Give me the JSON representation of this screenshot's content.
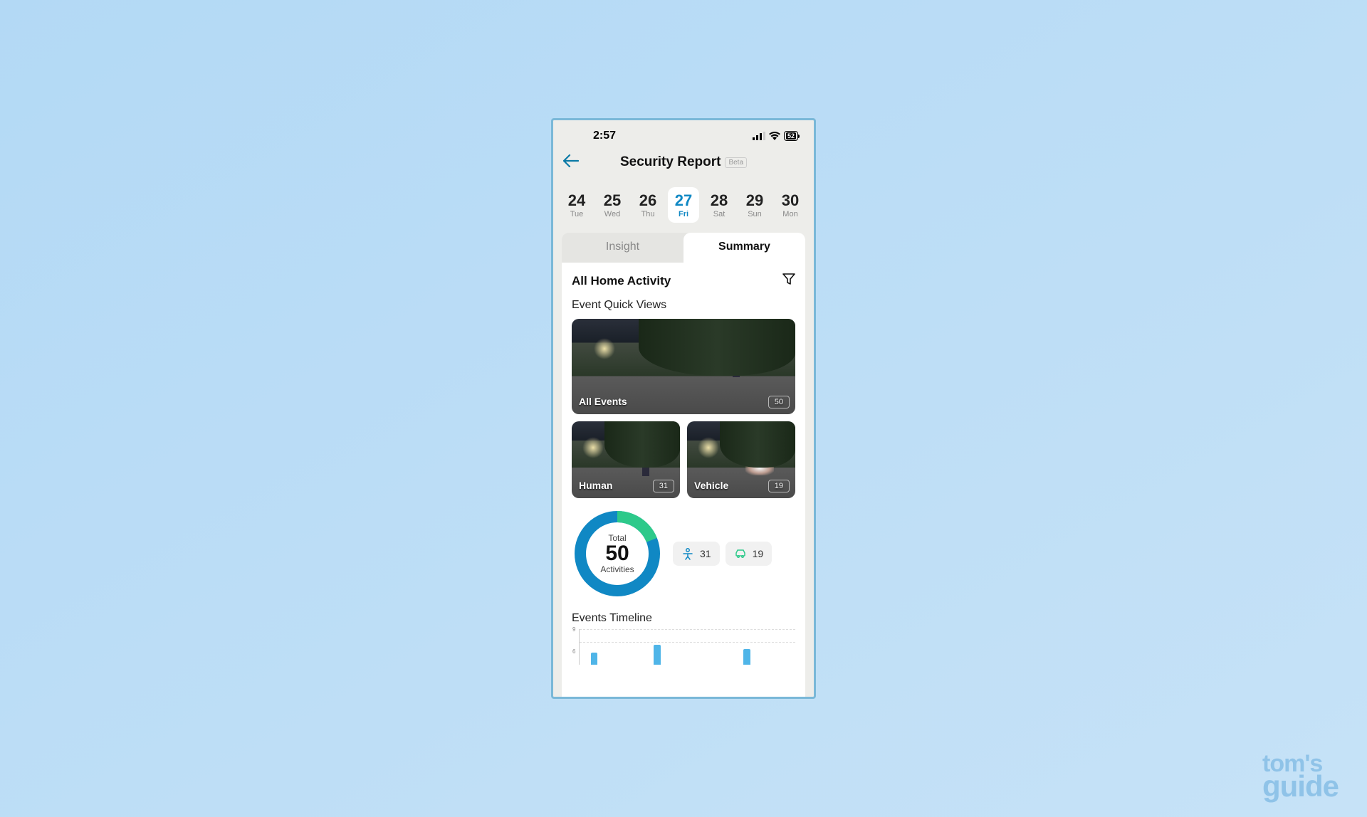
{
  "status": {
    "time": "2:57",
    "battery": "52"
  },
  "header": {
    "title": "Security Report",
    "badge": "Beta"
  },
  "dates": [
    {
      "num": "24",
      "day": "Tue"
    },
    {
      "num": "25",
      "day": "Wed"
    },
    {
      "num": "26",
      "day": "Thu"
    },
    {
      "num": "27",
      "day": "Fri",
      "selected": true
    },
    {
      "num": "28",
      "day": "Sat"
    },
    {
      "num": "29",
      "day": "Sun"
    },
    {
      "num": "30",
      "day": "Mon"
    }
  ],
  "tabs": {
    "insight": "Insight",
    "summary": "Summary",
    "active": "summary"
  },
  "section": {
    "title": "All Home Activity",
    "quick_views": "Event Quick Views"
  },
  "events": {
    "all": {
      "label": "All Events",
      "count": "50"
    },
    "human": {
      "label": "Human",
      "count": "31"
    },
    "vehicle": {
      "label": "Vehicle",
      "count": "19"
    }
  },
  "donut": {
    "top_label": "Total",
    "value": "50",
    "bottom_label": "Activities"
  },
  "chips": {
    "human": "31",
    "vehicle": "19"
  },
  "timeline": {
    "title": "Events Timeline"
  },
  "chart_data": {
    "type": "bar",
    "title": "Events Timeline",
    "ylabel": "",
    "ylim": [
      0,
      9
    ],
    "yticks": [
      6,
      9
    ],
    "x_count": 24,
    "values": [
      0,
      3,
      0,
      0,
      0,
      0,
      0,
      0,
      5,
      0,
      0,
      0,
      0,
      0,
      0,
      0,
      0,
      0,
      4,
      0,
      0,
      0,
      0,
      0
    ]
  },
  "watermark": {
    "line1": "tom's",
    "line2": "guide"
  }
}
